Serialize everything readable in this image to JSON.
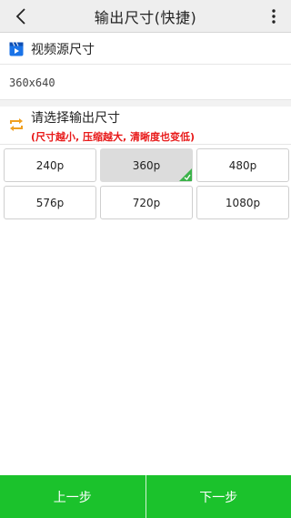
{
  "header": {
    "title": "输出尺寸(快捷)",
    "back_icon": "chevron-left-icon",
    "menu_icon": "more-vertical-icon"
  },
  "source": {
    "label": "视频源尺寸",
    "value": "360x640",
    "icon": "video-icon",
    "icon_color": "#1a73e8"
  },
  "output": {
    "label": "请选择输出尺寸",
    "hint": "(尺寸越小, 压缩越大, 清晰度也变低)",
    "icon": "swap-icon",
    "icon_color": "#f0a020",
    "hint_color": "#e81919"
  },
  "resolutions": [
    {
      "label": "240p",
      "selected": false
    },
    {
      "label": "360p",
      "selected": true
    },
    {
      "label": "480p",
      "selected": false
    },
    {
      "label": "576p",
      "selected": false
    },
    {
      "label": "720p",
      "selected": false
    },
    {
      "label": "1080p",
      "selected": false
    }
  ],
  "footer": {
    "prev_label": "上一步",
    "next_label": "下一步",
    "color": "#1bc22c"
  }
}
